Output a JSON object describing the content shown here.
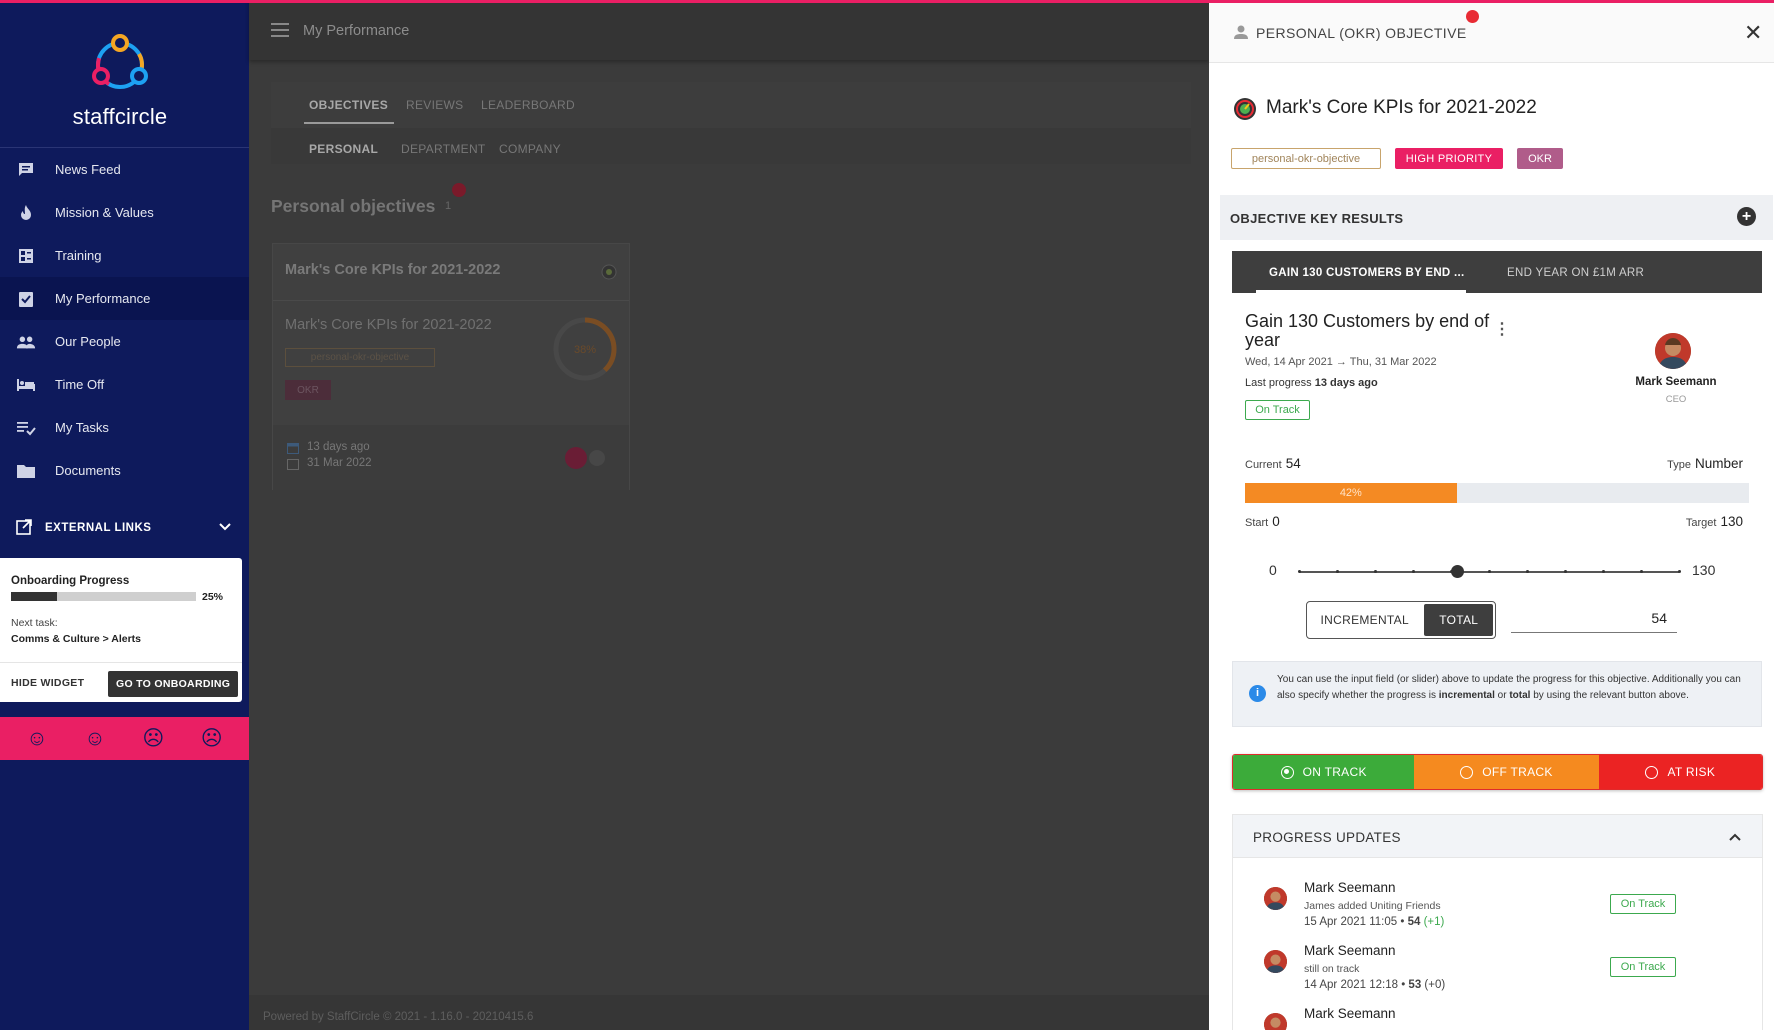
{
  "brand": {
    "logo_text": "staffcircle"
  },
  "sidebar": {
    "items": [
      {
        "label": "News Feed",
        "icon": "chat-icon"
      },
      {
        "label": "Mission & Values",
        "icon": "flame-icon"
      },
      {
        "label": "Training",
        "icon": "training-icon"
      },
      {
        "label": "My Performance",
        "icon": "clipboard-check-icon"
      },
      {
        "label": "Our People",
        "icon": "people-icon"
      },
      {
        "label": "Time Off",
        "icon": "bed-icon"
      },
      {
        "label": "My Tasks",
        "icon": "tasks-icon"
      },
      {
        "label": "Documents",
        "icon": "folder-icon"
      }
    ],
    "external_links": "EXTERNAL LINKS"
  },
  "onboarding": {
    "title": "Onboarding Progress",
    "progress": 0.25,
    "progress_label": "25%",
    "next_label": "Next task:",
    "next_task": "Comms & Culture > Alerts",
    "hide_label": "HIDE WIDGET",
    "go_label": "GO TO ONBOARDING"
  },
  "main": {
    "header_title": "My Performance",
    "tabs": [
      "OBJECTIVES",
      "REVIEWS",
      "LEADERBOARD"
    ],
    "sub_tabs": [
      "PERSONAL",
      "DEPARTMENT",
      "COMPANY"
    ],
    "section_title": "Personal objectives",
    "section_count": "1",
    "card": {
      "title": "Mark's Core KPIs for 2021-2022",
      "subtitle": "Mark's Core KPIs for 2021-2022",
      "tag": "personal-okr-objective",
      "tag2": "OKR",
      "ring_label": "38%",
      "ring_value": 0.38,
      "date1": "13 days ago",
      "date2": "31 Mar 2022"
    },
    "footer": "Powered by StaffCircle © 2021 - 1.16.0 - 20210415.6"
  },
  "panel": {
    "header": "PERSONAL (OKR) OBJECTIVE",
    "title": "Mark's Core KPIs for 2021-2022",
    "tags": {
      "type": "personal-okr-objective",
      "priority": "HIGH PRIORITY",
      "kind": "OKR"
    },
    "key_results_label": "OBJECTIVE KEY RESULTS",
    "kr_tabs": [
      "GAIN 130 CUSTOMERS BY END ...",
      "END YEAR ON £1M ARR"
    ],
    "kr": {
      "title": "Gain 130 Customers by end of year",
      "dates": "Wed, 14 Apr 2021 → Thu, 31 Mar 2022",
      "last_progress_label": "Last progress",
      "last_progress_value": "13 days ago",
      "status": "On Track",
      "owner_name": "Mark Seemann",
      "owner_role": "CEO",
      "current_label": "Current",
      "current": "54",
      "type_label": "Type",
      "type": "Number",
      "progress": 0.42,
      "progress_label": "42%",
      "start_label": "Start",
      "start": "0",
      "target_label": "Target",
      "target": "130",
      "slider_min": "0",
      "slider_max": "130",
      "slider_value": 54,
      "toggle_incremental": "INCREMENTAL",
      "toggle_total": "TOTAL",
      "input_value": "54"
    },
    "info": {
      "part1": "You can use the input field (or slider) above to update the progress for this objective. Additionally you can also specify whether the progress is ",
      "b1": "incremental",
      "mid": " or ",
      "b2": "total",
      "part2": " by using the relevant button above."
    },
    "status_buttons": [
      "ON TRACK",
      "OFF TRACK",
      "AT RISK"
    ],
    "progress_updates": {
      "label": "PROGRESS UPDATES",
      "items": [
        {
          "name": "Mark Seemann",
          "note": "James added Uniting Friends",
          "date": "15 Apr 2021 11:05",
          "value": "54",
          "delta": "(+1)",
          "status": "On Track"
        },
        {
          "name": "Mark Seemann",
          "note": "still on track",
          "date": "14 Apr 2021 12:18",
          "value": "53",
          "delta": "(+0)",
          "status": "On Track"
        },
        {
          "name": "Mark Seemann",
          "note": "",
          "date": "",
          "value": "",
          "delta": "",
          "status": ""
        }
      ]
    }
  },
  "colors": {
    "sidebar": "#0e1a5c",
    "accent": "#ea1f64",
    "on_track": "#3cab3a",
    "off_track": "#f58a1f",
    "at_risk": "#eb2323"
  }
}
